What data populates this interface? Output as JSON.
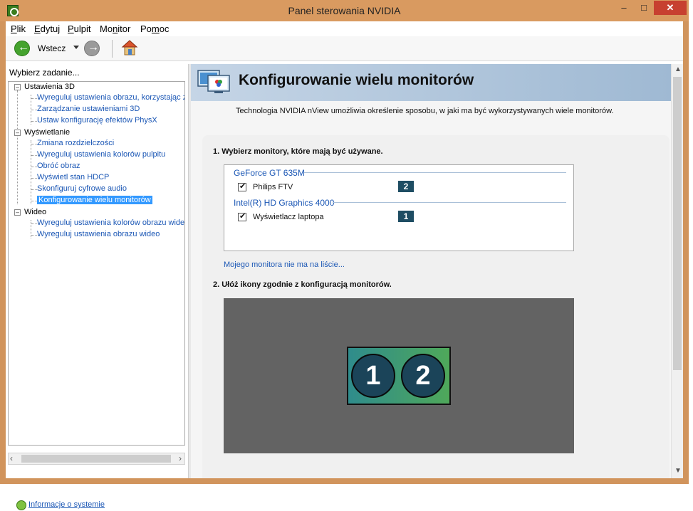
{
  "window": {
    "title": "Panel sterowania NVIDIA",
    "controls": {
      "minimize": "–",
      "maximize": "□",
      "close": "✕"
    }
  },
  "menu": {
    "items": [
      {
        "hotkey": "P",
        "rest": "lik"
      },
      {
        "hotkey": "E",
        "rest": "dytuj"
      },
      {
        "hotkey": "P",
        "rest": "ulpit"
      },
      {
        "pre": "Mo",
        "hotkey": "n",
        "rest": "itor"
      },
      {
        "pre": "Po",
        "hotkey": "m",
        "rest": "oc"
      }
    ]
  },
  "toolbar": {
    "back_label": "Wstecz",
    "icons": [
      "back-arrow-icon",
      "dropdown-arrow-icon",
      "forward-arrow-icon",
      "home-icon"
    ]
  },
  "left_pane": {
    "task_header": "Wybierz zadanie...",
    "tree": [
      {
        "label": "Ustawienia 3D",
        "expanded": true,
        "children": [
          "Wyreguluj ustawienia obrazu, korzystając z",
          "Zarządzanie ustawieniami 3D",
          "Ustaw konfigurację efektów PhysX"
        ]
      },
      {
        "label": "Wyświetlanie",
        "expanded": true,
        "children": [
          "Zmiana rozdzielczości",
          "Wyreguluj ustawienia kolorów pulpitu",
          "Obróć obraz",
          "Wyświetl stan HDCP",
          "Skonfiguruj cyfrowe audio",
          "Konfigurowanie wielu monitorów"
        ]
      },
      {
        "label": "Wideo",
        "expanded": true,
        "children": [
          "Wyreguluj ustawienia kolorów obrazu wideo",
          "Wyreguluj ustawienia obrazu wideo"
        ]
      }
    ],
    "selected_item": "Konfigurowanie wielu monitorów",
    "system_info_link": "Informacje o systemie"
  },
  "main": {
    "page_title": "Konfigurowanie wielu monitorów",
    "description": "Technologia NVIDIA nView umożliwia określenie sposobu, w jaki ma być wykorzystywanych wiele monitorów.",
    "step1": "1. Wybierz monitory, które mają być używane.",
    "gpus": [
      {
        "name": "GeForce GT 635M",
        "monitors": [
          {
            "name": "Philips FTV",
            "checked": true,
            "number": "2"
          }
        ]
      },
      {
        "name": "Intel(R) HD Graphics 4000",
        "monitors": [
          {
            "name": "Wyświetlacz laptopa",
            "checked": true,
            "number": "1"
          }
        ]
      }
    ],
    "not_listed_link": "Mojego monitora nie ma na liście...",
    "step2": "2. Ułóż ikony zgodnie z konfiguracją monitorów.",
    "arrangement": {
      "monitors": [
        "1",
        "2"
      ]
    }
  },
  "colors": {
    "title_bar": "#d99a60",
    "link_blue": "#1b57b5",
    "selection": "#3399ff",
    "badge": "#1e4d63",
    "arrange_bg": "#636363"
  }
}
